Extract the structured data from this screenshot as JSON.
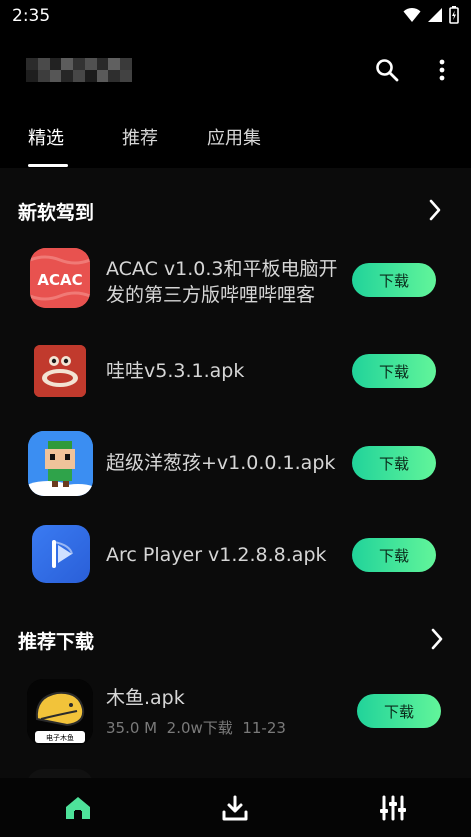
{
  "status_bar": {
    "time": "2:35"
  },
  "tabs": [
    {
      "label": "精选",
      "active": true
    },
    {
      "label": "推荐",
      "active": false
    },
    {
      "label": "应用集",
      "active": false
    }
  ],
  "sections": {
    "new_apps": {
      "title": "新软驾到",
      "items": [
        {
          "name": "ACAC v1.0.3和平板电脑开发的第三方版哔哩哔哩客",
          "icon": "acac-app-icon",
          "icon_text": "ACAC",
          "button": "下载"
        },
        {
          "name": "哇哇v5.3.1.apk",
          "icon": "wawa-app-icon",
          "button": "下载"
        },
        {
          "name": "超级洋葱孩+v1.0.0.1.apk",
          "icon": "super-onion-kid-app-icon",
          "button": "下载"
        },
        {
          "name": "Arc Player v1.2.8.8.apk",
          "icon": "arc-player-app-icon",
          "button": "下载"
        }
      ]
    },
    "recommended": {
      "title": "推荐下载",
      "items": [
        {
          "name": "木鱼.apk",
          "size": "35.0 M",
          "downloads": "2.0w下载",
          "date": "11-23",
          "icon": "wooden-fish-app-icon",
          "icon_text": "电子木鱼",
          "button": "下载"
        }
      ]
    }
  },
  "bottom_nav": [
    {
      "icon": "home-icon",
      "active": true
    },
    {
      "icon": "download-icon",
      "active": false
    },
    {
      "icon": "settings-sliders-icon",
      "active": false
    }
  ],
  "colors": {
    "accent_start": "#21d39a",
    "accent_end": "#62f59a",
    "background": "#000000",
    "content_background": "#0b0b0b",
    "active_nav": "#4ee29a"
  }
}
